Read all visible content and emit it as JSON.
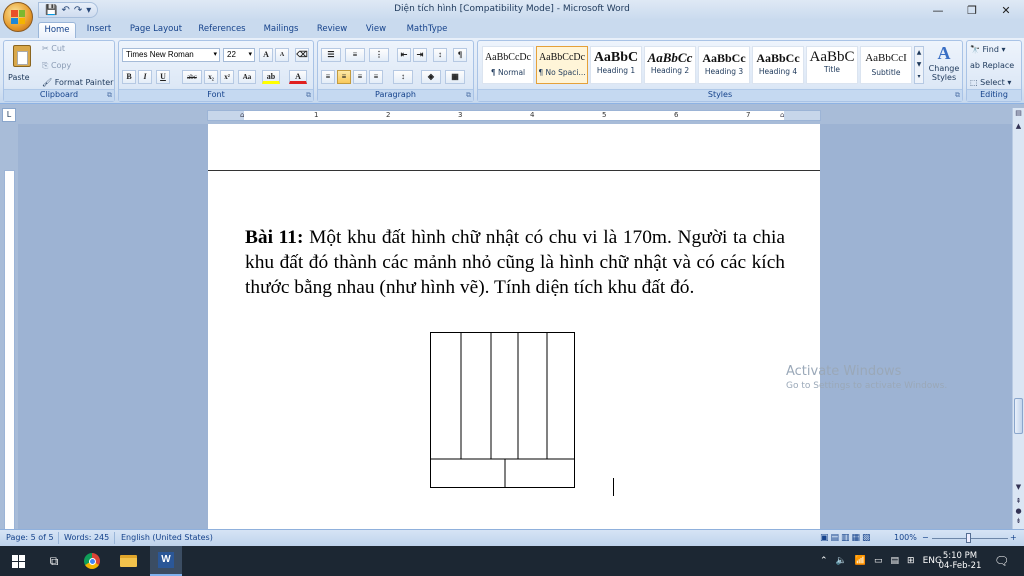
{
  "window": {
    "title": "Diện tích hình [Compatibility Mode] - Microsoft Word",
    "minimize": "—",
    "restore": "❐",
    "close": "✕"
  },
  "qat": {
    "save": "💾",
    "undo": "↶",
    "redo": "↷",
    "more": "▾"
  },
  "tabs": [
    "Home",
    "Insert",
    "Page Layout",
    "References",
    "Mailings",
    "Review",
    "View",
    "MathType"
  ],
  "clipboard": {
    "label": "Clipboard",
    "paste": "Paste",
    "cut": "Cut",
    "copy": "Copy",
    "format_painter": "Format Painter"
  },
  "font": {
    "label": "Font",
    "name": "Times New Roman",
    "size": "22",
    "grow": "A",
    "shrink": "A",
    "bold": "B",
    "italic": "I",
    "underline": "U",
    "strike": "abc",
    "subscript": "x₂",
    "superscript": "x²",
    "case": "Aa"
  },
  "paragraph": {
    "label": "Paragraph"
  },
  "styles": {
    "label": "Styles",
    "items": [
      {
        "preview": "AaBbCcDc",
        "name": "¶ Normal"
      },
      {
        "preview": "AaBbCcDc",
        "name": "¶ No Spaci..."
      },
      {
        "preview": "AaBbC",
        "name": "Heading 1"
      },
      {
        "preview": "AaBbCc",
        "name": "Heading 2"
      },
      {
        "preview": "AaBbCc",
        "name": "Heading 3"
      },
      {
        "preview": "AaBbCc",
        "name": "Heading 4"
      },
      {
        "preview": "AaBbC",
        "name": "Title"
      },
      {
        "preview": "AaBbCcI",
        "name": "Subtitle"
      }
    ],
    "change_styles_1": "Change",
    "change_styles_2": "Styles"
  },
  "editing": {
    "label": "Editing",
    "find": "Find",
    "replace": "Replace",
    "select": "Select"
  },
  "ruler": {
    "corner": "L",
    "numbers": [
      "1",
      "2",
      "3",
      "4",
      "5",
      "6",
      "7"
    ]
  },
  "document": {
    "heading": "Bài 11:",
    "body": " Một khu đất hình chữ nhật có chu vi là 170m. Người ta chia khu đất đó thành các mảnh nhỏ cũng là hình chữ nhật và có các kích thước bằng nhau (như hình vẽ). Tính diện tích khu đất đó."
  },
  "watermark": {
    "line1": "Activate Windows",
    "line2": "Go to Settings to activate Windows."
  },
  "status": {
    "page": "Page: 5 of 5",
    "words": "Words: 245",
    "language": "English (United States)",
    "zoom": "100%",
    "zoom_minus": "−",
    "zoom_plus": "+"
  },
  "taskbar": {
    "language": "ENG",
    "time": "5:10 PM",
    "date": "04-Feb-21"
  }
}
